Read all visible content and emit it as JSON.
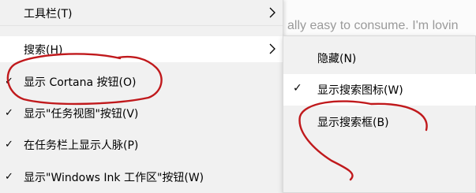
{
  "background": {
    "document_text": "ally easy to consume. I'm lovin"
  },
  "main_menu": {
    "items": [
      {
        "label": "工具栏(T)",
        "checked": false,
        "has_submenu": true,
        "highlighted": false
      },
      {
        "label": "搜索(H)",
        "checked": false,
        "has_submenu": true,
        "highlighted": true
      },
      {
        "label": "显示 Cortana 按钮(O)",
        "checked": true,
        "has_submenu": false,
        "highlighted": false
      },
      {
        "label": "显示\"任务视图\"按钮(V)",
        "checked": true,
        "has_submenu": false,
        "highlighted": false
      },
      {
        "label": "在任务栏上显示人脉(P)",
        "checked": true,
        "has_submenu": false,
        "highlighted": false
      },
      {
        "label": "显示\"Windows Ink 工作区\"按钮(W)",
        "checked": true,
        "has_submenu": false,
        "highlighted": false
      }
    ]
  },
  "sub_menu": {
    "items": [
      {
        "label": "隐藏(N)",
        "checked": false,
        "highlighted": false
      },
      {
        "label": "显示搜索图标(W)",
        "checked": true,
        "highlighted": true
      },
      {
        "label": "显示搜索框(B)",
        "checked": false,
        "highlighted": false
      }
    ]
  },
  "icons": {
    "check": "check-icon",
    "submenu_arrow": "chevron-right-icon"
  },
  "colors": {
    "menu_bg": "#f1f1f1",
    "highlight_bg": "#ffffff",
    "annotation_red": "#c0191c"
  }
}
